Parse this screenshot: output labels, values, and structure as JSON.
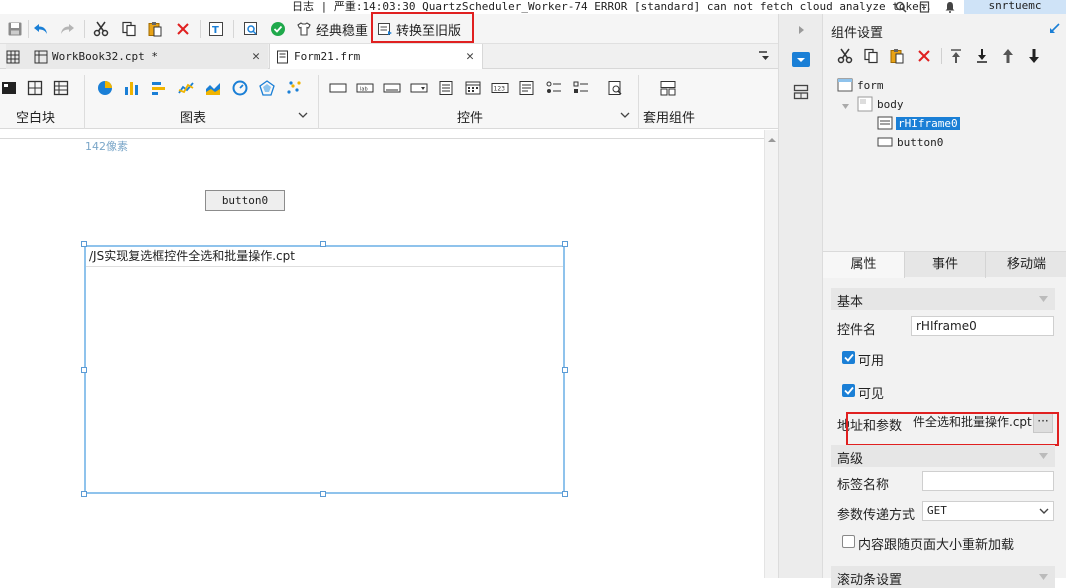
{
  "topbar": {
    "log": "日志 | 严重:14:03:30 QuartzScheduler_Worker-74 ERROR [standard] can not fetch cloud analyze token.",
    "user": "snrtuemc"
  },
  "toolbar": {
    "classic_label": "经典稳重",
    "convert_label": "转换至旧版"
  },
  "tabs": [
    {
      "label": "WorkBook32.cpt *"
    },
    {
      "label": "Form21.frm"
    }
  ],
  "ribbon": {
    "group_blank": "空白块",
    "group_chart": "图表",
    "group_controls": "控件",
    "group_template": "套用组件"
  },
  "canvas": {
    "ruler_text": "142像素",
    "button_label": "button0",
    "iframe_url": "/JS实现复选框控件全选和批量操作.cpt"
  },
  "panel": {
    "title": "组件设置",
    "tree": [
      {
        "label": "form"
      },
      {
        "label": "body"
      },
      {
        "label": "rHIframe0"
      },
      {
        "label": "button0"
      }
    ],
    "tabs": [
      "属性",
      "事件",
      "移动端"
    ],
    "section_basic": "基本",
    "name_label": "控件名",
    "name_value": "rHIframe0",
    "enabled_label": "可用",
    "visible_label": "可见",
    "url_label": "地址和参数",
    "url_value": "件全选和批量操作.cpt",
    "section_advanced": "高级",
    "tag_label": "标签名称",
    "tag_value": "",
    "method_label": "参数传递方式",
    "method_value": "GET",
    "reload_label": "内容跟随页面大小重新加载",
    "scroll_label": "滚动条设置"
  },
  "colors": {
    "accent": "#1a7fd6",
    "highlight": "#e02020",
    "selection": "#5b9bd5"
  }
}
